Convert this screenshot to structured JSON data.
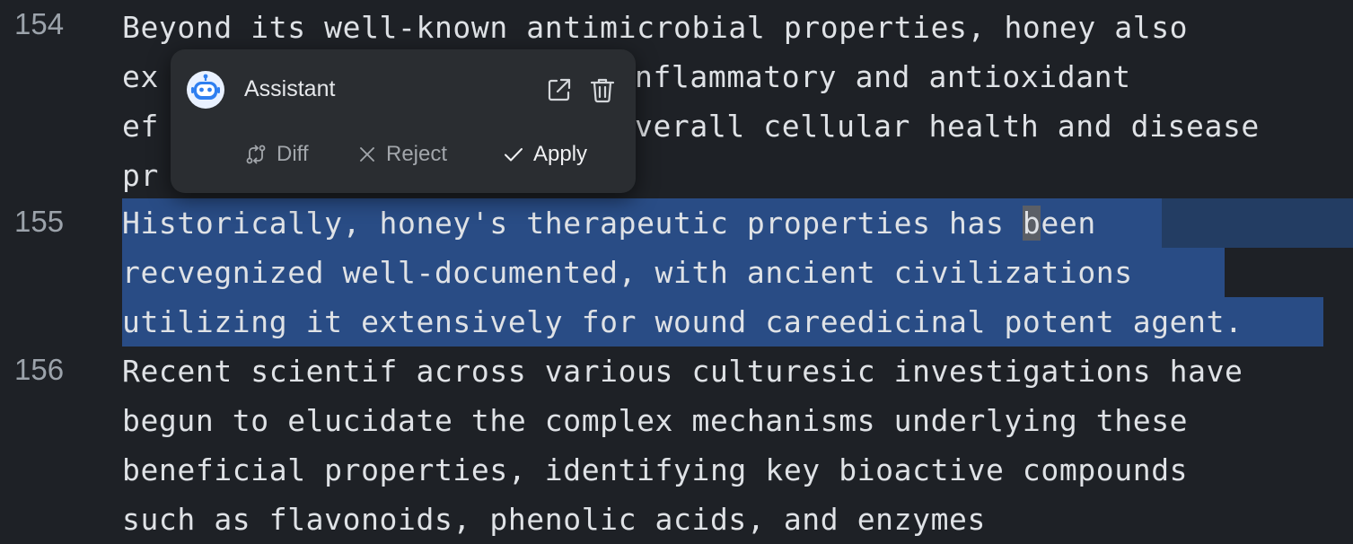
{
  "editor": {
    "line_numbers": [
      "154",
      "155",
      "156"
    ],
    "lines": [
      {
        "id": "154-1",
        "text": "Beyond its well-known antimicrobial properties, honey also"
      },
      {
        "id": "154-2",
        "text": "ex",
        "text_b": "nflammatory and antioxidant"
      },
      {
        "id": "154-3",
        "text": "ef",
        "text_b": "verall cellular health and disease"
      },
      {
        "id": "154-4",
        "text": "pr"
      },
      {
        "id": "155-1",
        "text_pre": "Historically, honey's therapeutic properties has ",
        "text_cursor": "b",
        "text_post": "een"
      },
      {
        "id": "155-2",
        "text": "recvegnized well-documented, with ancient civilizations"
      },
      {
        "id": "155-3",
        "text": "utilizing it extensively for wound careedicinal potent agent."
      },
      {
        "id": "156-1",
        "text": "Recent scientif across various culturesic investigations have"
      },
      {
        "id": "156-2",
        "text": "begun to elucidate the complex mechanisms underlying these"
      },
      {
        "id": "156-3",
        "text": "beneficial properties, identifying key bioactive compounds"
      },
      {
        "id": "156-4",
        "text": "such as flavonoids, phenolic acids, and enzymes"
      }
    ]
  },
  "popup": {
    "title": "Assistant",
    "avatar_icon": "robot-icon",
    "actions": {
      "diff": "Diff",
      "reject": "Reject",
      "apply": "Apply"
    },
    "header_icons": [
      "open-external-icon",
      "trash-icon"
    ]
  },
  "colors": {
    "background": "#1e2126",
    "selection": "#294c85",
    "accent": "#2f7ff0"
  }
}
